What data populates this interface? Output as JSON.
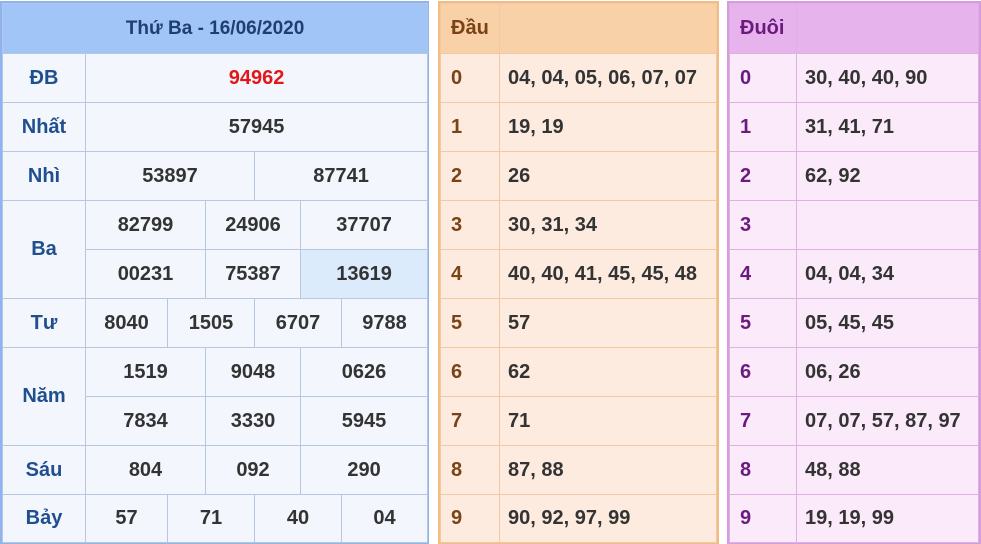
{
  "results": {
    "title": "Thứ Ba - 16/06/2020",
    "db": {
      "label": "ĐB",
      "value": "94962"
    },
    "nhat": {
      "label": "Nhất",
      "value": "57945"
    },
    "nhi": {
      "label": "Nhì",
      "values": [
        "53897",
        "87741"
      ]
    },
    "ba": {
      "label": "Ba",
      "values": [
        "82799",
        "24906",
        "37707",
        "00231",
        "75387",
        "13619"
      ]
    },
    "tu": {
      "label": "Tư",
      "values": [
        "8040",
        "1505",
        "6707",
        "9788"
      ]
    },
    "nam": {
      "label": "Năm",
      "values": [
        "1519",
        "9048",
        "0626",
        "7834",
        "3330",
        "5945"
      ]
    },
    "sau": {
      "label": "Sáu",
      "values": [
        "804",
        "092",
        "290"
      ]
    },
    "bay": {
      "label": "Bảy",
      "values": [
        "57",
        "71",
        "40",
        "04"
      ]
    }
  },
  "dau": {
    "header": "Đầu",
    "rows": [
      {
        "digit": "0",
        "values": "04, 04, 05, 06, 07, 07"
      },
      {
        "digit": "1",
        "values": "19, 19"
      },
      {
        "digit": "2",
        "values": "26"
      },
      {
        "digit": "3",
        "values": "30, 31, 34"
      },
      {
        "digit": "4",
        "values": "40, 40, 41, 45, 45, 48"
      },
      {
        "digit": "5",
        "values": "57"
      },
      {
        "digit": "6",
        "values": "62"
      },
      {
        "digit": "7",
        "values": "71"
      },
      {
        "digit": "8",
        "values": "87, 88"
      },
      {
        "digit": "9",
        "values": "90, 92, 97, 99"
      }
    ]
  },
  "duoi": {
    "header": "Đuôi",
    "rows": [
      {
        "digit": "0",
        "values": "30, 40, 40, 90"
      },
      {
        "digit": "1",
        "values": "31, 41, 71"
      },
      {
        "digit": "2",
        "values": "62, 92"
      },
      {
        "digit": "3",
        "values": ""
      },
      {
        "digit": "4",
        "values": "04, 04, 34"
      },
      {
        "digit": "5",
        "values": "05, 45, 45"
      },
      {
        "digit": "6",
        "values": "06, 26"
      },
      {
        "digit": "7",
        "values": "07, 07, 57, 87, 97"
      },
      {
        "digit": "8",
        "values": "48, 88"
      },
      {
        "digit": "9",
        "values": "19, 19, 99"
      }
    ]
  }
}
